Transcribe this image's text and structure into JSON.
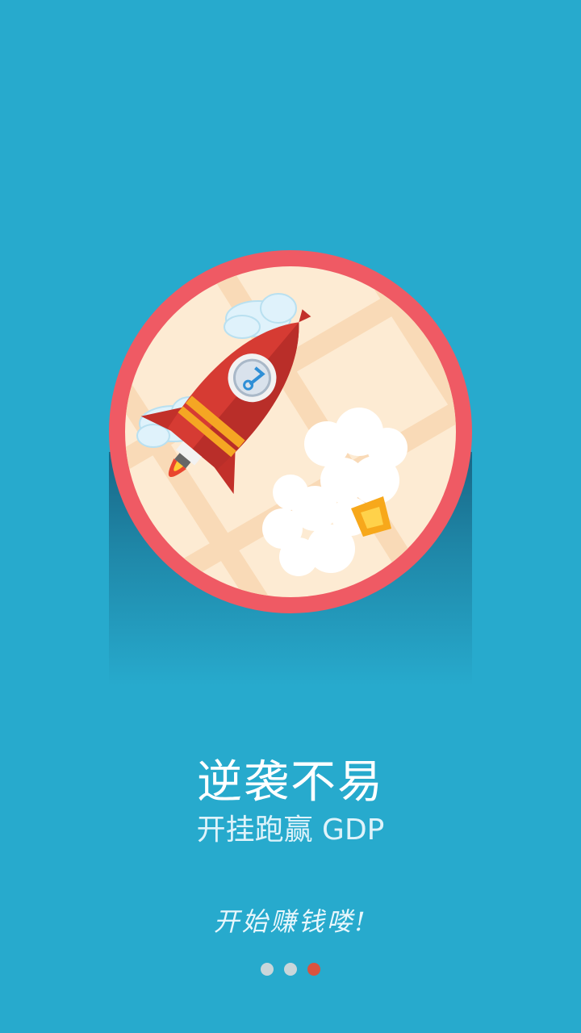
{
  "onboarding": {
    "headline": "逆袭不易",
    "subline": "开挂跑赢 GDP",
    "cta": "开始赚钱喽!"
  },
  "pager": {
    "count": 3,
    "active_index": 2
  },
  "illustration": {
    "icon": "rocket-launch-icon"
  },
  "colors": {
    "background": "#27aacd",
    "ring": "#ef5a64",
    "disc": "#fdebd3",
    "rocket": "#d63b33",
    "dot_inactive": "#c9d6da",
    "dot_active": "#d9533f"
  }
}
